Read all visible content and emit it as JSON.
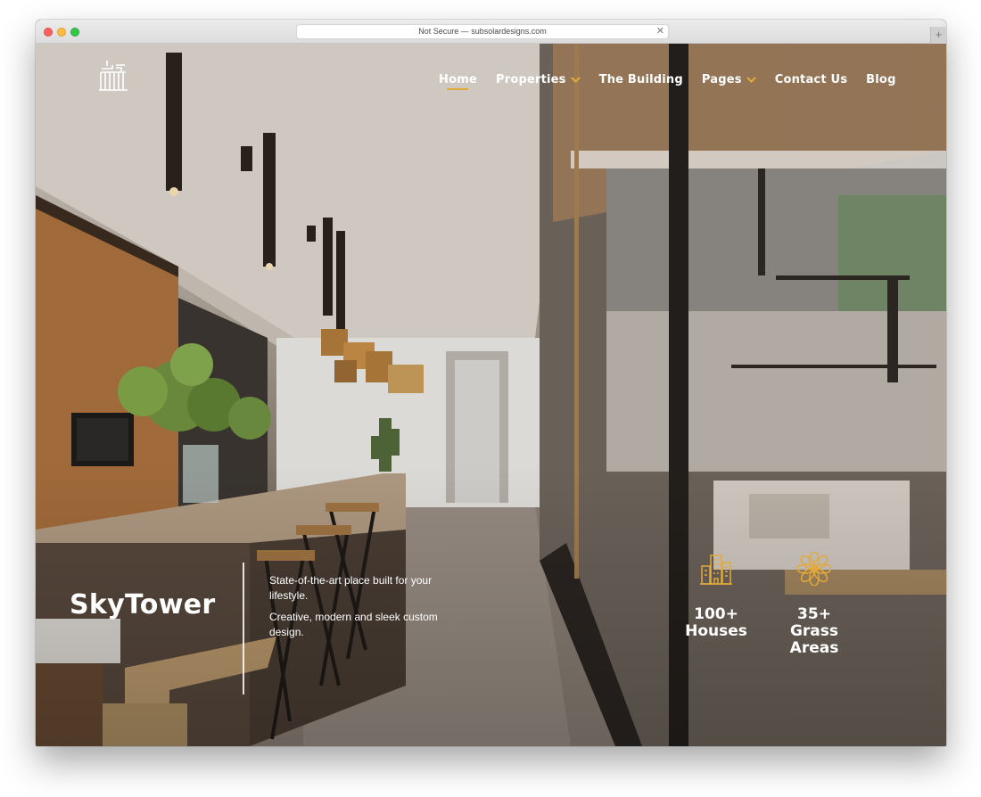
{
  "browser": {
    "address": "Not Secure — subsolardesigns.com"
  },
  "nav": {
    "items": [
      {
        "label": "Home",
        "active": true,
        "dropdown": false
      },
      {
        "label": "Properties",
        "active": false,
        "dropdown": true
      },
      {
        "label": "The Building",
        "active": false,
        "dropdown": false
      },
      {
        "label": "Pages",
        "active": false,
        "dropdown": true
      },
      {
        "label": "Contact Us",
        "active": false,
        "dropdown": false
      },
      {
        "label": "Blog",
        "active": false,
        "dropdown": false
      }
    ]
  },
  "hero": {
    "brand": "SkyTower",
    "tagline_1": "State-of-the-art place built for your lifestyle.",
    "tagline_2": "Creative, modern and sleek custom design."
  },
  "stats": [
    {
      "value": "100+",
      "label": "Houses",
      "icon": "buildings-icon"
    },
    {
      "value": "35+",
      "label": "Grass Areas",
      "icon": "flower-icon"
    }
  ],
  "colors": {
    "accent": "#e2a93b",
    "text": "#ffffff"
  }
}
